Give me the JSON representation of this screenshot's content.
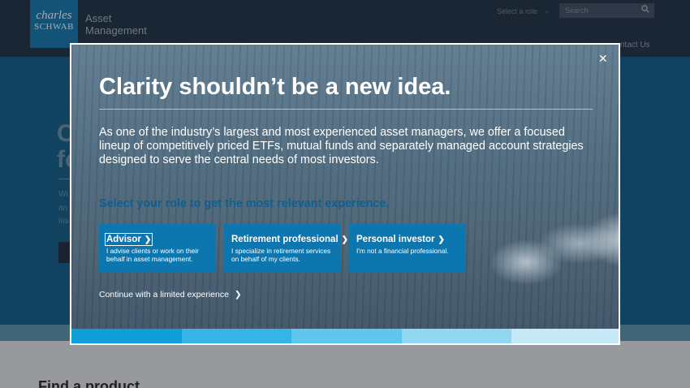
{
  "site": {
    "logo_line1": "charles",
    "logo_line2": "SCHWAB",
    "logo_sub_1": "Asset",
    "logo_sub_2": "Management",
    "role_select_label": "Select a role",
    "search_placeholder": "Search",
    "contact_label": "ntact Us",
    "hero_heading_1": "C",
    "hero_heading_2": "fo",
    "hero_text_1": "Wi",
    "hero_text_2": "an",
    "hero_text_3": "ins",
    "find_product": "Find a product"
  },
  "modal": {
    "close_label": "✕",
    "title": "Clarity shouldn’t be a new idea.",
    "body": "As one of the industry’s largest and most experienced asset managers, we offer a focused lineup of competitively priced ETFs, mutual funds and separately managed account strategies designed to serve the central needs of most investors.",
    "role_prompt": "Select your role to get the most relevant experience.",
    "roles": [
      {
        "title": "Advisor",
        "desc": "I advise clients or work on their behalf in asset management."
      },
      {
        "title": "Retirement professional",
        "desc": "I specialize in retirement services on behalf of my clients."
      },
      {
        "title": "Personal investor",
        "desc": "I'm not a financial professional."
      }
    ],
    "continue_label": "Continue with a limited experience",
    "bar_colors": [
      "#0e9fd9",
      "#35b4e6",
      "#5fc6ee",
      "#92d7f2",
      "#c6e9f7"
    ]
  }
}
